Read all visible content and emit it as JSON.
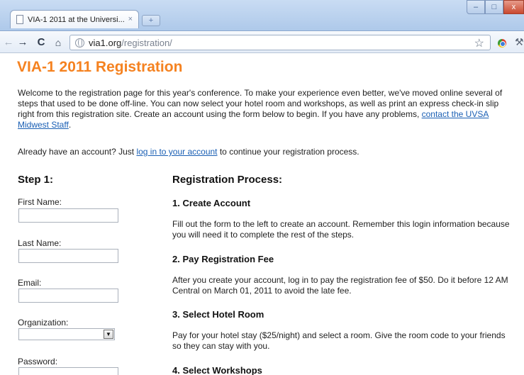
{
  "browser": {
    "tab_title": "VIA-1 2011 at the Universi...",
    "tab_close": "×",
    "new_tab": "+",
    "window_buttons": {
      "minimize": "–",
      "maximize": "□",
      "close": "x"
    },
    "nav": {
      "back": "←",
      "forward": "→",
      "reload": "C",
      "home": "⌂"
    },
    "url_host": "via1.org",
    "url_path": "/registration/",
    "star": "☆",
    "wrench": "⚒"
  },
  "page": {
    "title": "VIA-1 2011 Registration",
    "intro_text": "Welcome to the registration page for this year's conference. To make your experience even better, we've moved online several of steps that used to be done off-line. You can now select your hotel room and workshops, as well as print an express check-in slip right from this registration site. Create an account using the form below to begin. If you have any problems, ",
    "intro_link": "contact the UVSA Midwest Staff",
    "intro_end": ".",
    "already_text": "Already have an account? Just ",
    "already_link": "log in to your account",
    "already_end": " to continue your registration process."
  },
  "form": {
    "step_title": "Step 1:",
    "first_name_label": "First Name:",
    "first_name_value": "",
    "last_name_label": "Last Name:",
    "last_name_value": "",
    "email_label": "Email:",
    "email_value": "",
    "organization_label": "Organization:",
    "organization_selected": "",
    "organization_arrow": "▼",
    "password_label": "Password:",
    "password_value": ""
  },
  "process": {
    "title": "Registration Process:",
    "steps": [
      {
        "title": "1. Create Account",
        "desc": "Fill out the form to the left to create an account. Remember this login information because you will need it to complete the rest of the steps."
      },
      {
        "title": "2. Pay Registration Fee",
        "desc": "After you create your account, log in to pay the registration fee of $50. Do it before 12 AM Central on March 01, 2011 to avoid the late fee."
      },
      {
        "title": "3. Select Hotel Room",
        "desc": "Pay for your hotel stay ($25/night) and select a room. Give the room code to your friends so they can stay with you."
      },
      {
        "title": "4. Select Workshops",
        "desc": ""
      }
    ]
  }
}
